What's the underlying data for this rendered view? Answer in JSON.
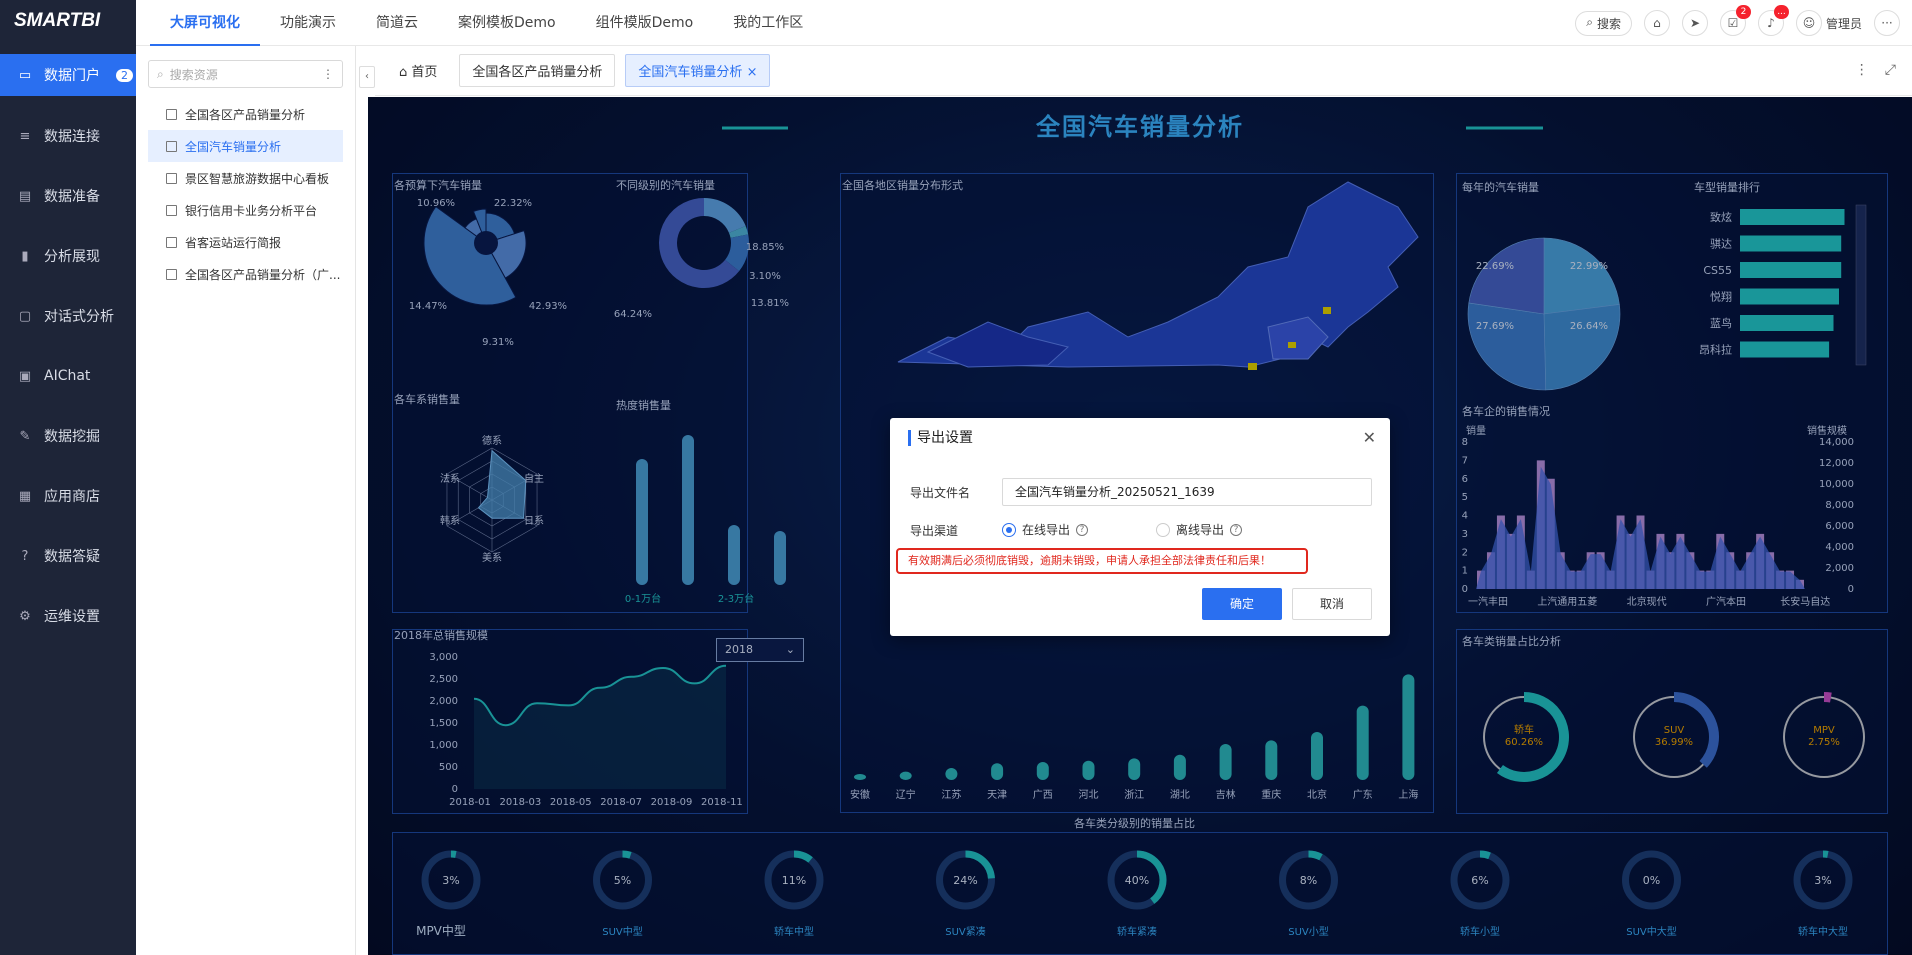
{
  "app": {
    "logo": "SMARTBI"
  },
  "topnav": [
    {
      "label": "大屏可视化",
      "active": true
    },
    {
      "label": "功能演示"
    },
    {
      "label": "简道云"
    },
    {
      "label": "案例模板Demo"
    },
    {
      "label": "组件模版Demo"
    },
    {
      "label": "我的工作区"
    }
  ],
  "topright": {
    "search": "搜索",
    "task_badge": "2",
    "bell_badge": "...",
    "user": "管理员"
  },
  "sidebar": [
    {
      "label": "数据门户",
      "badge": "2",
      "icon": "monitor-icon",
      "active": true
    },
    {
      "label": "数据连接",
      "icon": "database-icon"
    },
    {
      "label": "数据准备",
      "icon": "server-icon"
    },
    {
      "label": "分析展现",
      "icon": "bar-chart-icon"
    },
    {
      "label": "对话式分析",
      "icon": "chat-icon"
    },
    {
      "label": "AIChat",
      "icon": "ai-chat-icon"
    },
    {
      "label": "数据挖掘",
      "icon": "pencil-icon"
    },
    {
      "label": "应用商店",
      "icon": "apps-icon"
    },
    {
      "label": "数据答疑",
      "icon": "question-icon"
    },
    {
      "label": "运维设置",
      "icon": "gear-icon"
    }
  ],
  "resources": {
    "search_placeholder": "搜索资源",
    "items": [
      {
        "label": "全国各区产品销量分析"
      },
      {
        "label": "全国汽车销量分析",
        "active": true
      },
      {
        "label": "景区智慧旅游数据中心看板"
      },
      {
        "label": "银行信用卡业务分析平台"
      },
      {
        "label": "省客运站运行简报"
      },
      {
        "label": "全国各区产品销量分析（广..."
      }
    ]
  },
  "tabs": {
    "home": "首页",
    "tab1": "全国各区产品销量分析",
    "tab2": "全国汽车销量分析"
  },
  "dashboard": {
    "title": "全国汽车销量分析",
    "p1": "各预算下汽车销量",
    "p2": "不同级别的汽车销量",
    "p3": "各车系销售量",
    "p4": "热度销售量",
    "p5": "2018年总销售规模",
    "p6": "全国各地区销量分布形式",
    "p7": "每年的汽车销量",
    "p8": "车型销量排行",
    "p9": "各车企的销售情况",
    "p10": "各车类销量占比分析",
    "p11": "各车类分级别的销量占比",
    "year_select": "2018",
    "rose_labels": [
      "10.96%",
      "22.32%",
      "14.47%",
      "42.93%",
      "9.31%"
    ],
    "donut_labels": [
      "18.85%",
      "3.10%",
      "13.81%",
      "64.24%"
    ],
    "radar_axes": [
      "德系",
      "自主",
      "日系",
      "美系",
      "韩系",
      "法系"
    ],
    "heat_xlabels": [
      "0-1万台",
      "2-3万台"
    ],
    "pie_labels": [
      "22.69%",
      "22.99%",
      "27.69%",
      "26.64%"
    ],
    "rank_labels": [
      "致炫",
      "骐达",
      "CS55",
      "悦翔",
      "蓝鸟",
      "昂科拉"
    ],
    "rank_values": [
      0.95,
      0.92,
      0.92,
      0.9,
      0.85,
      0.81
    ],
    "dual_left_title": "销量",
    "dual_right_title": "销售规模",
    "dual_left_ticks": [
      "8",
      "7",
      "6",
      "5",
      "4",
      "3",
      "2",
      "1",
      "0"
    ],
    "dual_right_ticks": [
      "14,000",
      "12,000",
      "10,000",
      "8,000",
      "6,000",
      "4,000",
      "2,000",
      "0"
    ],
    "dual_xlabels": [
      "一汽丰田",
      "上汽通用五菱",
      "北京现代",
      "广汽本田",
      "长安马自达"
    ],
    "rings": [
      {
        "name": "轿车",
        "value": "60.26%",
        "color": "#22c4c9"
      },
      {
        "name": "SUV",
        "value": "36.99%",
        "color": "#3b6ed0"
      },
      {
        "name": "MPV",
        "value": "2.75%",
        "color": "#c94fc8"
      }
    ],
    "gauges": [
      {
        "value": "3%",
        "label": "MPV中型",
        "v": 0.03
      },
      {
        "value": "5%",
        "label": "SUV中型",
        "v": 0.05
      },
      {
        "value": "11%",
        "label": "轿车中型",
        "v": 0.11
      },
      {
        "value": "24%",
        "label": "SUV紧凑",
        "v": 0.24
      },
      {
        "value": "40%",
        "label": "轿车紧凑",
        "v": 0.4
      },
      {
        "value": "8%",
        "label": "SUV小型",
        "v": 0.08
      },
      {
        "value": "6%",
        "label": "轿车小型",
        "v": 0.06
      },
      {
        "value": "0%",
        "label": "SUV中大型",
        "v": 0
      },
      {
        "value": "3%",
        "label": "轿车中大型",
        "v": 0.03
      }
    ]
  },
  "chart_data": [
    {
      "type": "bar",
      "title": "全国各地区销量分布形式",
      "categories": [
        "安徽",
        "辽宁",
        "江苏",
        "天津",
        "广西",
        "河北",
        "浙江",
        "湖北",
        "吉林",
        "重庆",
        "北京",
        "广东",
        "上海"
      ],
      "values": [
        5,
        7,
        10,
        14,
        15,
        16,
        18,
        21,
        30,
        33,
        40,
        62,
        88
      ]
    },
    {
      "type": "line",
      "title": "2018年总销售规模",
      "x": [
        "2018-01",
        "2018-03",
        "2018-05",
        "2018-07",
        "2018-09",
        "2018-11"
      ],
      "yticks": [
        "3,000",
        "2,500",
        "2,000",
        "1,500",
        "1,000",
        "500",
        "0"
      ],
      "ylim": [
        0,
        3000
      ],
      "values": [
        2050,
        1450,
        1950,
        1900,
        2300,
        2550,
        2750,
        2400,
        2800
      ]
    },
    {
      "type": "bar",
      "title": "热度销售量",
      "values": [
        105,
        125,
        50,
        45
      ]
    }
  ],
  "modal": {
    "title": "导出设置",
    "filename_label": "导出文件名",
    "filename_value": "全国汽车销量分析_20250521_1639",
    "channel_label": "导出渠道",
    "online": "在线导出",
    "offline": "离线导出",
    "warning": "有效期满后必须彻底销毁，逾期未销毁，申请人承担全部法律责任和后果！",
    "ok": "确定",
    "cancel": "取消"
  }
}
